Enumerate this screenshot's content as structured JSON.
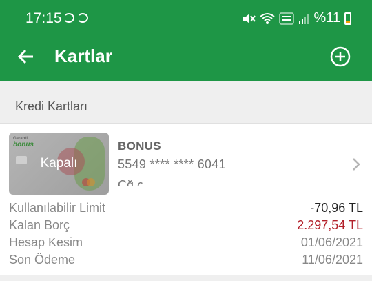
{
  "status_bar": {
    "time": "17:15",
    "battery_text": "%11",
    "icons": [
      "sync-icon",
      "sync-icon",
      "mute-icon",
      "wifi-icon",
      "volte-icon",
      "signal-icon",
      "battery-icon"
    ]
  },
  "header": {
    "title": "Kartlar",
    "back_icon": "arrow-left-icon",
    "add_icon": "plus-circle-icon",
    "color": "#1e9646"
  },
  "section": {
    "title": "Kredi Kartları"
  },
  "card": {
    "image_brand": "bonus",
    "image_brand_small": "Garanti",
    "status_label": "Kapalı",
    "name": "BONUS",
    "number": "5549 **** **** 6041",
    "holder": "Cğ                        ς",
    "details": [
      {
        "label": "Kullanılabilir Limit",
        "value": "-70,96 TL",
        "style": "dark"
      },
      {
        "label": "Kalan Borç",
        "value": "2.297,54 TL",
        "style": "red"
      },
      {
        "label": "Hesap Kesim",
        "value": "01/06/2021",
        "style": "muted"
      },
      {
        "label": "Son Ödeme",
        "value": "11/06/2021",
        "style": "muted"
      }
    ]
  },
  "colors": {
    "accent": "#1e9646",
    "debt": "#b3202a"
  }
}
